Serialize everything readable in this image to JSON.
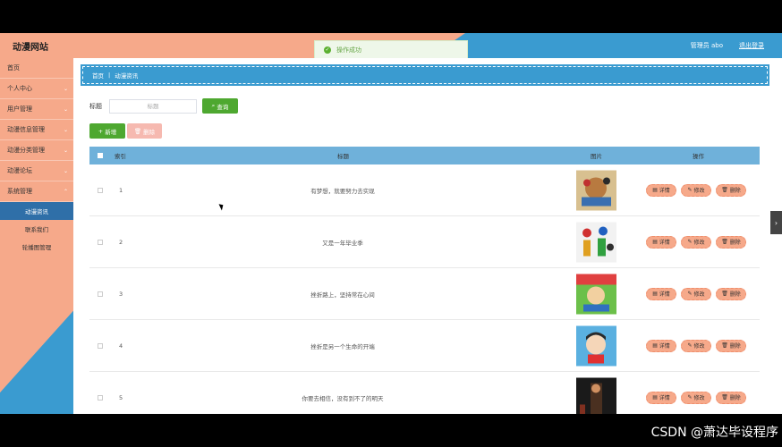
{
  "header": {
    "brand": "动漫网站",
    "toast": "操作成功",
    "admin_label": "管理员 abo",
    "logout_label": "退出登录"
  },
  "sidebar": {
    "items": [
      {
        "label": "首页"
      },
      {
        "label": "个人中心"
      },
      {
        "label": "用户管理"
      },
      {
        "label": "动漫信息管理"
      },
      {
        "label": "动漫分类管理"
      },
      {
        "label": "动漫论坛"
      },
      {
        "label": "系统管理"
      }
    ],
    "sub_items": [
      {
        "label": "动漫资讯",
        "active": true
      },
      {
        "label": "联系我们",
        "active": false
      },
      {
        "label": "轮播图管理",
        "active": false
      }
    ]
  },
  "breadcrumb": {
    "home": "首页",
    "current": "动漫资讯"
  },
  "search": {
    "label": "标题",
    "placeholder": "标题",
    "button": "查询"
  },
  "toolbar": {
    "add_label": "新增",
    "delete_label": "删除"
  },
  "table": {
    "headers": {
      "index": "索引",
      "title": "标题",
      "image": "图片",
      "actions": "操作"
    },
    "rows": [
      {
        "index": "1",
        "title": "有梦想，就要努力去实现"
      },
      {
        "index": "2",
        "title": "又是一年毕业季"
      },
      {
        "index": "3",
        "title": "挫折路上，坚持常在心间"
      },
      {
        "index": "4",
        "title": "挫折是另一个生命的开端"
      },
      {
        "index": "5",
        "title": "你要去相信，没有到不了的明天"
      }
    ],
    "actions": {
      "detail": "详情",
      "edit": "修改",
      "delete": "删除"
    }
  },
  "watermark": "CSDN @萧达毕设程序",
  "colors": {
    "peach": "#f6a98a",
    "blue": "#3a9bd0",
    "green": "#4ea830"
  }
}
